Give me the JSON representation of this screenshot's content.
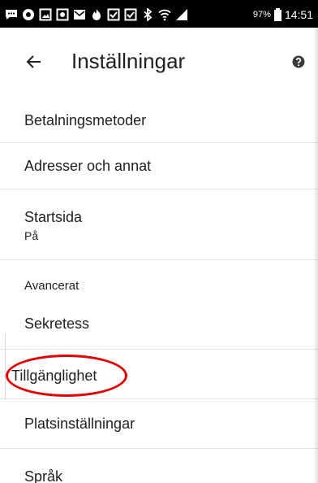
{
  "status_bar": {
    "icons": [
      "message-icon",
      "record-icon",
      "image-icon",
      "photo-icon",
      "mail-icon",
      "fire-icon",
      "check-box-icon",
      "check-box-icon",
      "bluetooth-icon",
      "wifi-icon",
      "signal-icon"
    ],
    "battery": "97%",
    "time": "14:51"
  },
  "header": {
    "back_icon": "arrow-left-icon",
    "title": "Inställningar",
    "help_icon": "help-circle-icon"
  },
  "settings": {
    "items": [
      {
        "label": "Betalningsmetoder"
      },
      {
        "label": "Adresser och annat"
      },
      {
        "label": "Startsida",
        "sublabel": "På"
      },
      {
        "label": "Sekretess"
      },
      {
        "label": "Tillgänglighet"
      },
      {
        "label": "Platsinställningar"
      },
      {
        "label": "Språk"
      }
    ],
    "section_header": "Avancerat"
  },
  "annotation": {
    "color": "#e00000"
  }
}
